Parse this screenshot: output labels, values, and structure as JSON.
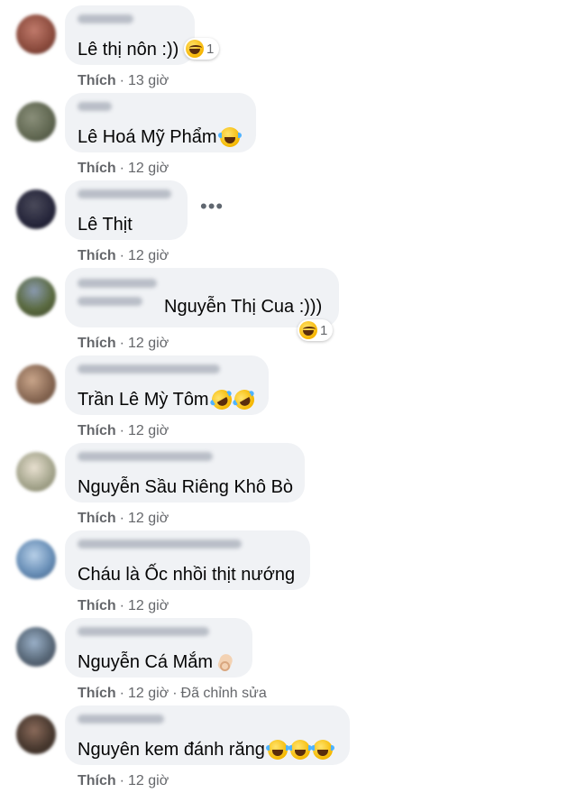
{
  "like_label": "Thích",
  "edited_label": "Đã chỉnh sửa",
  "comments": [
    {
      "text": "Lê thị nôn :))",
      "time": "13 giờ",
      "reaction_count": "1"
    },
    {
      "text": "Lê Hoá Mỹ Phẩm",
      "time": "12 giờ"
    },
    {
      "text": "Lê Thịt",
      "time": "12 giờ"
    },
    {
      "text": "Nguyễn Thị Cua :)))",
      "time": "12 giờ",
      "reaction_count": "1"
    },
    {
      "text": "Trần Lê Mỳ Tôm",
      "time": "12 giờ"
    },
    {
      "text": "Nguyễn Sầu Riêng Khô Bò",
      "time": "12 giờ"
    },
    {
      "text": "Cháu là Ốc nhồi thịt nướng",
      "time": "12 giờ"
    },
    {
      "text": "Nguyễn Cá Mắm",
      "time": "12 giờ"
    },
    {
      "text": "Nguyên kem đánh răng",
      "time": "12 giờ"
    }
  ],
  "more_icon": "ellipsis-icon",
  "colors": {
    "bubble": "#f0f2f5",
    "meta": "#65676b",
    "text": "#050505"
  }
}
